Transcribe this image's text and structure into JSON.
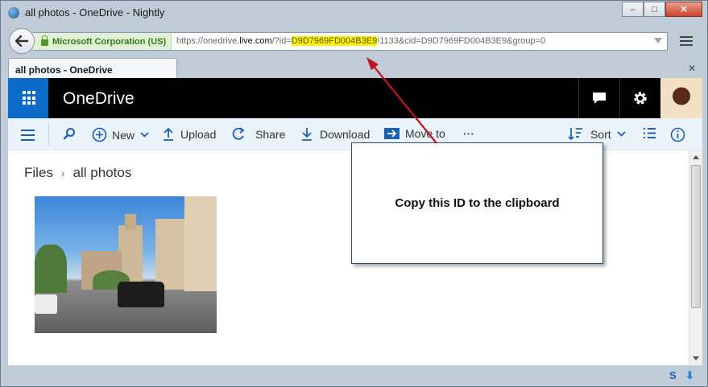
{
  "window": {
    "title": "all photos - OneDrive - Nightly",
    "minimize": "–",
    "maximize": "□",
    "close": "✕"
  },
  "nav": {
    "identity": "Microsoft Corporation (US)",
    "url_prefix": "https://onedrive.",
    "url_host": "live.com",
    "url_mid": "/?id=",
    "url_highlight": "D9D7969FD004B3E9",
    "url_suffix": "!1133&cid=D9D7969FD004B3E9&group=0"
  },
  "tabs": [
    {
      "label": "all photos - OneDrive"
    }
  ],
  "onedrive": {
    "brand": "OneDrive",
    "commands": {
      "new": "New",
      "upload": "Upload",
      "share": "Share",
      "download": "Download",
      "move_to": "Move to",
      "more": "···",
      "sort": "Sort"
    },
    "breadcrumb": {
      "root": "Files",
      "separator": "›",
      "current": "all photos"
    }
  },
  "callout": {
    "text": "Copy this ID to the clipboard"
  },
  "colors": {
    "accent": "#0b6bc8",
    "highlight": "#fff200",
    "arrow": "#c0161c"
  }
}
